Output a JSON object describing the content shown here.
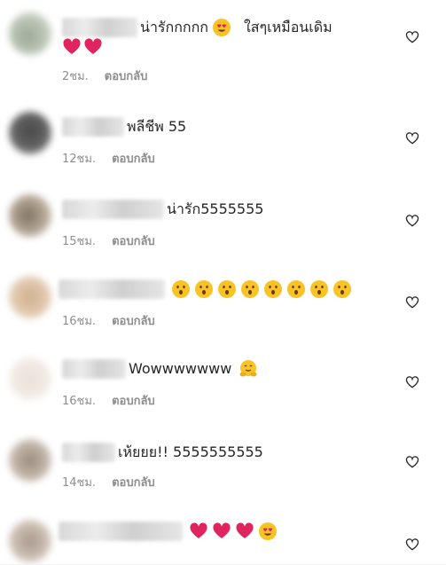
{
  "comments": [
    {
      "text": "น่ารักกกกก",
      "text2": "ใสๆเหมือนเดิม",
      "time": "2ชม.",
      "reply": "ตอบกลับ",
      "emojis": [
        "heart-eyes"
      ],
      "emojis2": [
        "red-heart",
        "red-heart"
      ]
    },
    {
      "text": "พลีชีพ 55",
      "time": "12ชม.",
      "reply": "ตอบกลับ",
      "emojis": []
    },
    {
      "text": "น่ารัก5555555",
      "time": "15ชม.",
      "reply": "ตอบกลับ",
      "emojis": []
    },
    {
      "text": "",
      "time": "16ชม.",
      "reply": "ตอบกลับ",
      "emojis": [
        "hushed-face",
        "hushed-face",
        "hushed-face",
        "hushed-face",
        "hushed-face",
        "hushed-face",
        "hushed-face",
        "hushed-face"
      ]
    },
    {
      "text": "Wowwwwwww",
      "time": "16ชม.",
      "reply": "ตอบกลับ",
      "emojis": [
        "hugging-face"
      ]
    },
    {
      "text": "เห้ยยย!! 5555555555",
      "time": "14ชม.",
      "reply": "ตอบกลับ",
      "emojis": []
    },
    {
      "text": "",
      "time": "",
      "reply": "",
      "emojis": [
        "red-heart",
        "red-heart",
        "red-heart",
        "heart-eyes"
      ]
    }
  ],
  "icons": {
    "like": "heart-outline-icon"
  },
  "colors": {
    "text": "#262626",
    "meta": "#8e8e8e",
    "heart": "#e0245e",
    "emoji": "#f7c325"
  }
}
